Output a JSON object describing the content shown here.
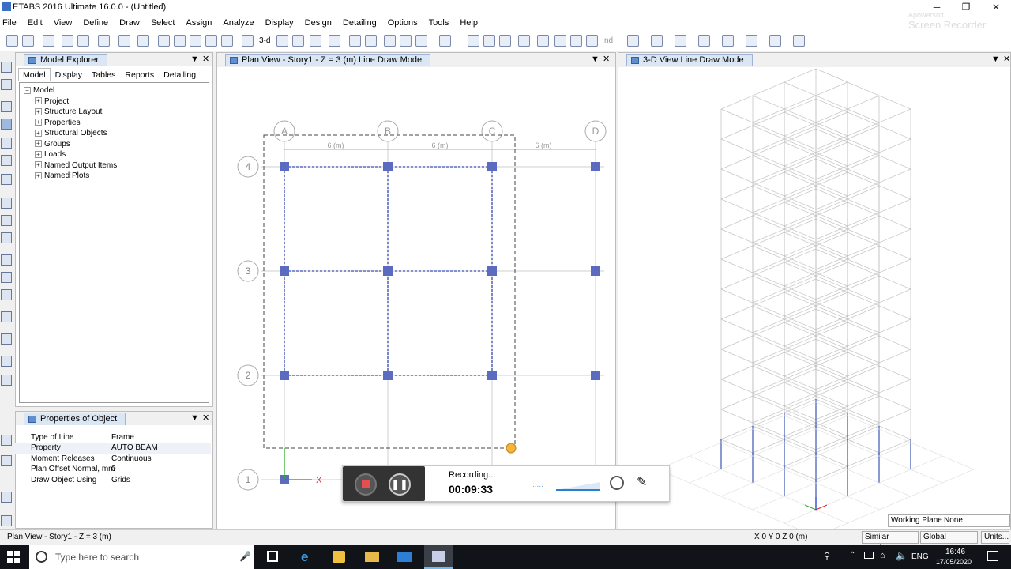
{
  "window": {
    "title": "ETABS 2016 Ultimate 16.0.0 - (Untitled)"
  },
  "menu": [
    "File",
    "Edit",
    "View",
    "Define",
    "Draw",
    "Select",
    "Assign",
    "Analyze",
    "Display",
    "Design",
    "Detailing",
    "Options",
    "Tools",
    "Help"
  ],
  "toolbar": {
    "label_3d": "3-d",
    "label_nd": "nd"
  },
  "model_explorer": {
    "title": "Model Explorer",
    "tabs": [
      "Model",
      "Display",
      "Tables",
      "Reports",
      "Detailing"
    ],
    "active_tab": "Model",
    "root": "Model",
    "items": [
      "Project",
      "Structure Layout",
      "Properties",
      "Structural Objects",
      "Groups",
      "Loads",
      "Named Output Items",
      "Named Plots"
    ]
  },
  "properties": {
    "title": "Properties of Object",
    "rows": [
      {
        "key": "Type of Line",
        "value": "Frame"
      },
      {
        "key": "Property",
        "value": "AUTO BEAM"
      },
      {
        "key": "Moment Releases",
        "value": "Continuous"
      },
      {
        "key": "Plan Offset Normal, mm",
        "value": "0"
      },
      {
        "key": "Draw Object Using",
        "value": "Grids"
      }
    ]
  },
  "plan_view": {
    "title": "Plan View - Story1 - Z = 3 (m)  Line Draw Mode",
    "grid_x": [
      "A",
      "B",
      "C",
      "D"
    ],
    "grid_y": [
      "4",
      "3",
      "2",
      "1"
    ],
    "spacing_labels": [
      "6 (m)",
      "6 (m)",
      "6 (m)"
    ],
    "axis_x": "X"
  },
  "view_3d": {
    "title": "3-D View  Line Draw Mode"
  },
  "recording": {
    "label": "Recording...",
    "time": "00:09:33",
    "dots": "....."
  },
  "watermark": {
    "line1": "Apowersoft",
    "line2": "Screen Recorder"
  },
  "status": {
    "left": "Plan View - Story1 - Z = 3 (m)",
    "coords": "X 0  Y 0  Z 0 (m)",
    "working_plane_label": "Working Plane",
    "working_plane_value": "None",
    "similar_stories": "Similar Stories",
    "global": "Global",
    "units": "Units..."
  },
  "taskbar": {
    "search": "Type here to search",
    "lang": "ENG",
    "time": "16:46",
    "date": "17/05/2020"
  },
  "colors": {
    "frame_blue": "#5b6bbf",
    "tab_blue": "#dbe6f4",
    "accent": "#0078d7"
  }
}
